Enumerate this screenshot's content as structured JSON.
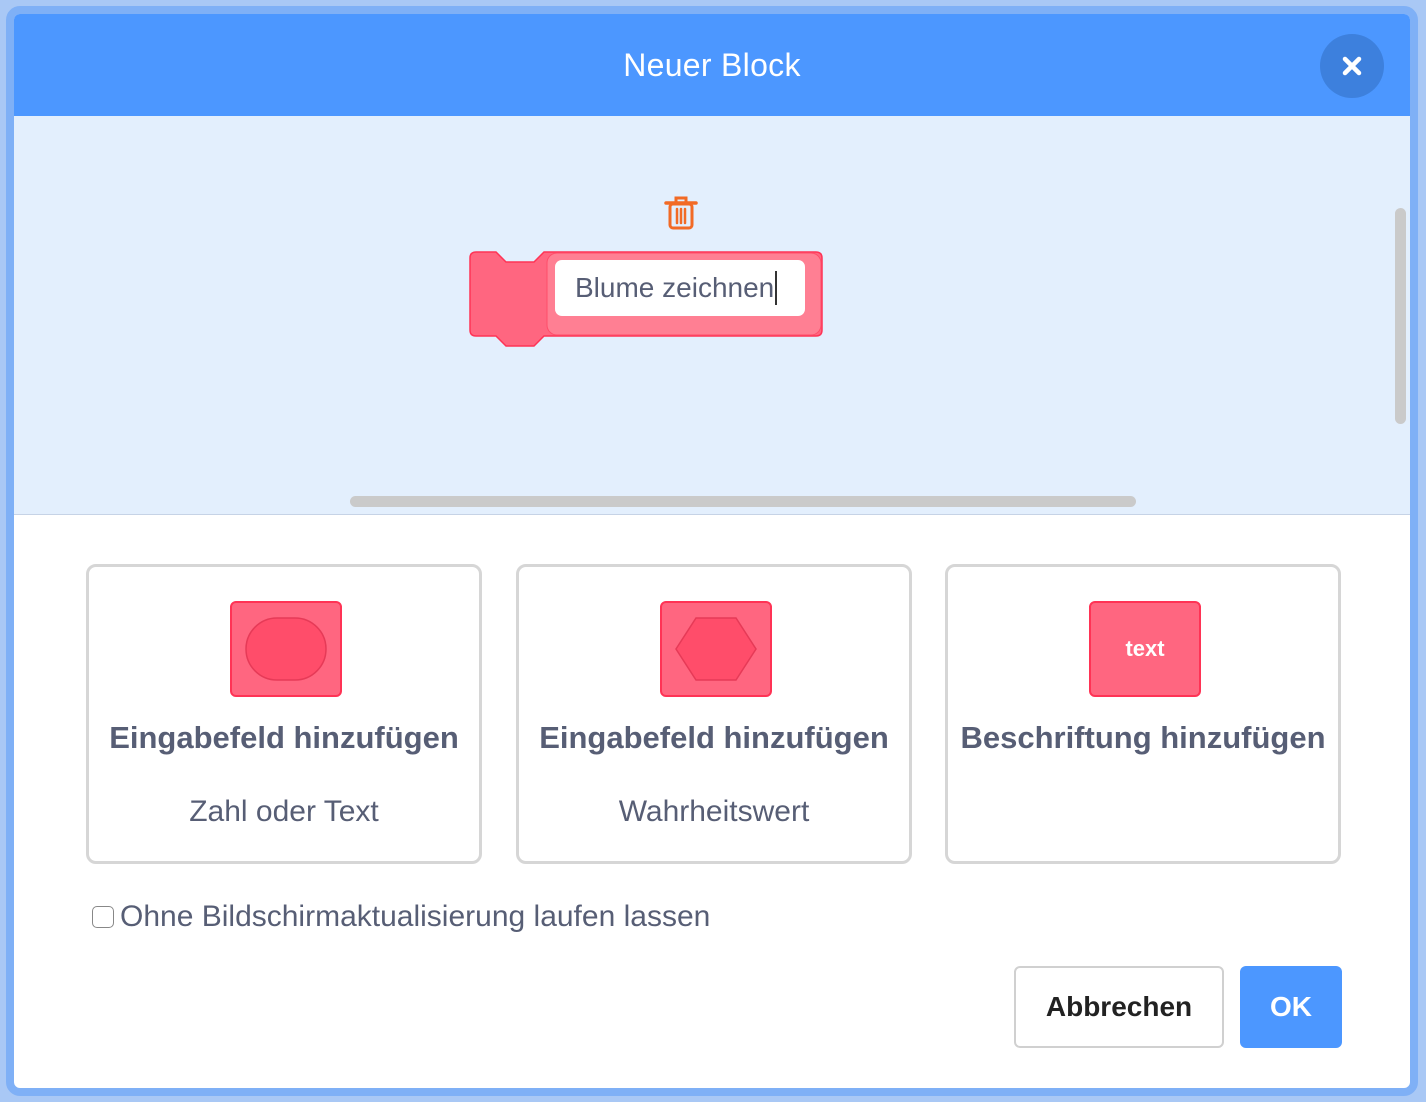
{
  "dialog": {
    "title": "Neuer Block",
    "accent_color": "#4c97ff",
    "block_color": "#ff6680"
  },
  "header": {
    "close_icon": "close-icon"
  },
  "workspace": {
    "block_name_value": "Blume zeichnen",
    "delete_icon": "trash-icon"
  },
  "options": [
    {
      "title": "Eingabefeld hinzufügen",
      "subtitle": "Zahl oder Text",
      "icon": "number-text-input-icon"
    },
    {
      "title": "Eingabefeld hinzufügen",
      "subtitle": "Wahrheitswert",
      "icon": "boolean-input-icon"
    },
    {
      "title": "Beschriftung hinzufügen",
      "subtitle": "",
      "icon": "label-icon",
      "icon_text": "text"
    }
  ],
  "run_without_refresh": {
    "label": "Ohne Bildschirmaktualisierung laufen lassen",
    "checked": false
  },
  "buttons": {
    "cancel_label": "Abbrechen",
    "ok_label": "OK"
  }
}
